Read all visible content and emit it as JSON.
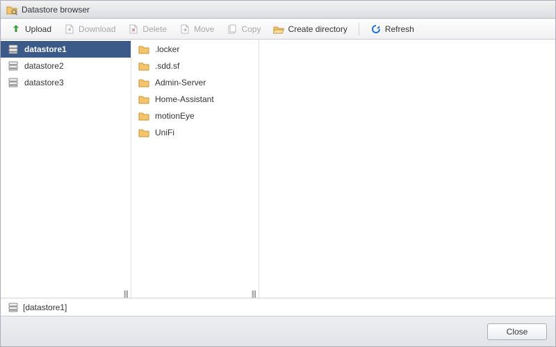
{
  "window": {
    "title": "Datastore browser"
  },
  "toolbar": {
    "upload": "Upload",
    "download": "Download",
    "delete": "Delete",
    "move": "Move",
    "copy": "Copy",
    "create_dir": "Create directory",
    "refresh": "Refresh"
  },
  "datastores": [
    {
      "name": "datastore1",
      "selected": true
    },
    {
      "name": "datastore2",
      "selected": false
    },
    {
      "name": "datastore3",
      "selected": false
    }
  ],
  "folders": [
    {
      "name": ".locker"
    },
    {
      "name": ".sdd.sf"
    },
    {
      "name": "Admin-Server"
    },
    {
      "name": "Home-Assistant"
    },
    {
      "name": "motionEye"
    },
    {
      "name": "UniFi"
    }
  ],
  "status": {
    "path": "[datastore1]"
  },
  "footer": {
    "close_label": "Close"
  },
  "icons": {
    "datastore_browser": "datastore-browser-icon",
    "upload": "upload-icon",
    "download": "download-icon",
    "delete": "delete-icon",
    "move": "move-icon",
    "copy": "copy-icon",
    "create_dir": "folder-open-icon",
    "refresh": "refresh-icon",
    "datastore": "datastore-icon",
    "folder": "folder-icon"
  },
  "colors": {
    "selection": "#3b5a8a",
    "folder_fill": "#f4c56b",
    "folder_stroke": "#c8923a",
    "upload_green": "#3a9e36",
    "refresh_blue": "#1f6fd6",
    "disabled_grey": "#b7b9bd"
  }
}
